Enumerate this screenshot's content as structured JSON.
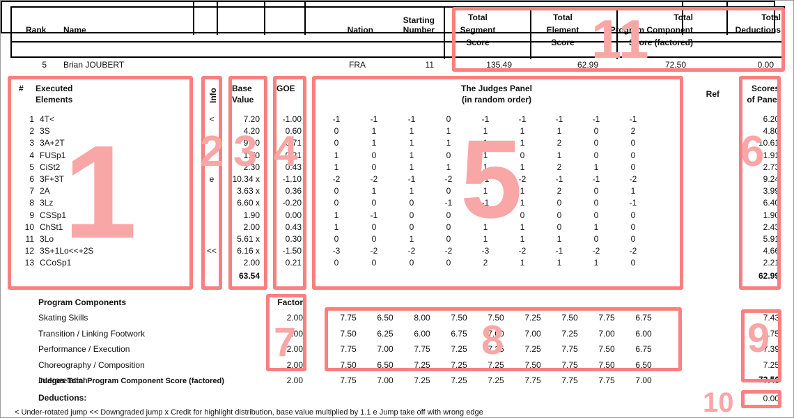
{
  "header": {
    "columns": [
      "Rank",
      "Name",
      "Nation",
      "Starting\nNumber"
    ],
    "rank_label": "Rank",
    "name_label": "Name",
    "nation_label": "Nation",
    "starting_number_label_1": "Starting",
    "starting_number_label_2": "Number",
    "total_segment_1": "Total",
    "total_segment_2": "Segment",
    "total_segment_3": "Score",
    "total_element_1": "Total",
    "total_element_2": "Element",
    "total_element_3": "Score",
    "total_component_1": "Total",
    "total_component_2": "Program  Component",
    "total_component_3": "Score (factored)",
    "total_deductions_1": "Total",
    "total_deductions_2": "Deductions"
  },
  "skater": {
    "rank": "5",
    "name": "Brian JOUBERT",
    "nation": "FRA",
    "starting_number": "11",
    "total_segment_score": "135.49",
    "total_element_score": "62.99",
    "total_component_score": "72.50",
    "total_deductions": "0.00"
  },
  "elements_header": {
    "num": "#",
    "executed_1": "Executed",
    "executed_2": "Elements",
    "info": "Info",
    "base_1": "Base",
    "base_2": "Value",
    "goe": "GOE",
    "judges_1": "The Judges Panel",
    "judges_2": "(in random order)",
    "ref": "Ref",
    "scores_1": "Scores",
    "scores_2": "of Panel"
  },
  "elements": [
    {
      "n": "1",
      "name": "4T<",
      "info": "<",
      "base": "7.20",
      "goe": "-1.00",
      "judges": [
        "-1",
        "-1",
        "-1",
        "0",
        "-1",
        "-1",
        "-1",
        "-1",
        "-1"
      ],
      "score": "6.20"
    },
    {
      "n": "2",
      "name": "3S",
      "info": "",
      "base": "4.20",
      "goe": "0.60",
      "judges": [
        "0",
        "1",
        "1",
        "1",
        "1",
        "1",
        "1",
        "0",
        "2"
      ],
      "score": "4.80"
    },
    {
      "n": "3",
      "name": "3A+2T",
      "info": "",
      "base": "9.90",
      "goe": "0.71",
      "judges": [
        "0",
        "1",
        "1",
        "1",
        "1",
        "1",
        "2",
        "0",
        "0"
      ],
      "score": "10.61"
    },
    {
      "n": "4",
      "name": "FUSp1",
      "info": "",
      "base": "1.70",
      "goe": "0.21",
      "judges": [
        "1",
        "0",
        "1",
        "0",
        "1",
        "0",
        "1",
        "0",
        "0"
      ],
      "score": "1.91"
    },
    {
      "n": "5",
      "name": "CiSt2",
      "info": "",
      "base": "2.30",
      "goe": "0.43",
      "judges": [
        "1",
        "0",
        "1",
        "1",
        "1",
        "1",
        "2",
        "1",
        "0"
      ],
      "score": "2.73"
    },
    {
      "n": "6",
      "name": "3F+3T",
      "info": "e",
      "base": "10.34 x",
      "goe": "-1.10",
      "judges": [
        "-2",
        "-2",
        "-1",
        "-2",
        "-1",
        "-2",
        "-1",
        "-1",
        "-2"
      ],
      "score": "9.24"
    },
    {
      "n": "7",
      "name": "2A",
      "info": "",
      "base": "3.63 x",
      "goe": "0.36",
      "judges": [
        "0",
        "1",
        "1",
        "0",
        "1",
        "1",
        "2",
        "0",
        "1"
      ],
      "score": "3.99"
    },
    {
      "n": "8",
      "name": "3Lz",
      "info": "",
      "base": "6.60 x",
      "goe": "-0.20",
      "judges": [
        "0",
        "0",
        "0",
        "-1",
        "-1",
        "1",
        "0",
        "0",
        "-1"
      ],
      "score": "6.40"
    },
    {
      "n": "9",
      "name": "CSSp1",
      "info": "",
      "base": "1.90",
      "goe": "0.00",
      "judges": [
        "1",
        "-1",
        "0",
        "0",
        "0",
        "0",
        "0",
        "0",
        "0"
      ],
      "score": "1.90"
    },
    {
      "n": "10",
      "name": "ChSt1",
      "info": "",
      "base": "2.00",
      "goe": "0.43",
      "judges": [
        "1",
        "0",
        "0",
        "0",
        "1",
        "1",
        "0",
        "1",
        "0"
      ],
      "score": "2.43"
    },
    {
      "n": "11",
      "name": "3Lo",
      "info": "",
      "base": "5.61 x",
      "goe": "0.30",
      "judges": [
        "0",
        "0",
        "1",
        "0",
        "1",
        "1",
        "1",
        "0",
        "0"
      ],
      "score": "5.91"
    },
    {
      "n": "12",
      "name": "3S+1Lo<<+2S",
      "info": "<<",
      "base": "6.16 x",
      "goe": "-1.50",
      "judges": [
        "-3",
        "-2",
        "-2",
        "-2",
        "-3",
        "-2",
        "-1",
        "-2",
        "-2"
      ],
      "score": "4.66"
    },
    {
      "n": "13",
      "name": "CCoSp1",
      "info": "",
      "base": "2.00",
      "goe": "0.21",
      "judges": [
        "0",
        "0",
        "0",
        "0",
        "2",
        "1",
        "1",
        "1",
        "0"
      ],
      "score": "2.21"
    }
  ],
  "totals": {
    "base_value_total": "63.54",
    "elements_score_total": "62.99"
  },
  "components": {
    "title": "Program Components",
    "factor_label": "Factor",
    "rows": [
      {
        "label": "Skating Skills",
        "factor": "2.00",
        "judges": [
          "7.75",
          "6.50",
          "8.00",
          "7.50",
          "7.50",
          "7.25",
          "7.50",
          "7.75",
          "6.75"
        ],
        "score": "7.43"
      },
      {
        "label": "Transition / Linking Footwork",
        "factor": "2.00",
        "judges": [
          "7.50",
          "6.25",
          "6.00",
          "6.75",
          "7.00",
          "7.00",
          "7.25",
          "7.00",
          "6.00"
        ],
        "score": "6.75"
      },
      {
        "label": "Performance / Execution",
        "factor": "2.00",
        "judges": [
          "7.75",
          "7.00",
          "7.75",
          "7.25",
          "7.25",
          "7.25",
          "7.75",
          "7.50",
          "6.75"
        ],
        "score": "7.39"
      },
      {
        "label": "Choreography / Composition",
        "factor": "2.00",
        "judges": [
          "7.50",
          "6.50",
          "7.25",
          "7.25",
          "7.25",
          "7.50",
          "7.75",
          "7.50",
          "6.50"
        ],
        "score": "7.25"
      },
      {
        "label": "Interpretation",
        "factor": "2.00",
        "judges": [
          "7.75",
          "7.00",
          "7.25",
          "7.25",
          "7.25",
          "7.75",
          "7.75",
          "7.75",
          "7.00"
        ],
        "score": "7.43"
      }
    ],
    "total_label": "Judges Total Program Component Score (factored)",
    "total_value": "72.50"
  },
  "deductions": {
    "label": "Deductions:",
    "value": "0.00"
  },
  "legend": "<  Under-rotated jump   <<  Downgraded jump   x  Credit for highlight distribution, base value multiplied by 1.1   e  Jump take off with wrong edge",
  "annotations": {
    "color": "#fa7f7f",
    "number_color": "#f9a6a6",
    "labels": [
      "1",
      "2",
      "3",
      "4",
      "5",
      "6",
      "7",
      "8",
      "9",
      "10",
      "11"
    ]
  }
}
